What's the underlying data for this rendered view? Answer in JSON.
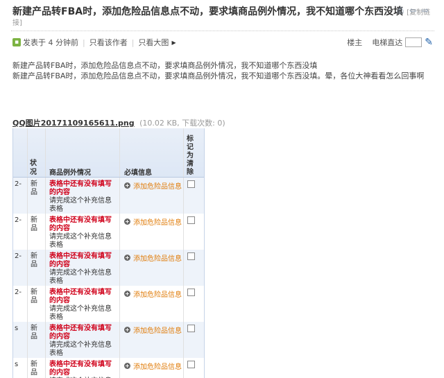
{
  "thread": {
    "title": "新建产品转FBA时，添加危险品信息点不动，要求填商品例外情况，我不知道哪个东西没填",
    "copy_link": "[复制链",
    "copy_link_end": "接]"
  },
  "meta": {
    "posted": "发表于 4 分钟前",
    "only_author": "只看该作者",
    "big_image": "只看大图",
    "floor": "楼主",
    "goto_label": "电梯直达"
  },
  "post": {
    "line1": "新建产品转FBA时，添加危险品信息点不动，要求填商品例外情况，我不知道哪个东西没填",
    "line2": "新建产品转FBA时，添加危险品信息点不动，要求填商品例外情况，我不知道哪个东西没填。晕，各位大神看看怎么回事啊"
  },
  "attachment": {
    "name": "QQ图片20171109165611.png",
    "info": "(10.02 KB, 下载次数: 0)"
  },
  "screenshot_table": {
    "headers": {
      "status": "状况",
      "info": "商品例外情况",
      "required": "必填信息",
      "mark": "标记为清除"
    },
    "rows": [
      {
        "id": "2-",
        "status": "新品",
        "warn": "表格中还有没有填写的内容",
        "note": "请完成这个补充信息表格",
        "action": "添加危险品信息"
      },
      {
        "id": "2-",
        "status": "新品",
        "warn": "表格中还有没有填写的内容",
        "note": "请完成这个补充信息表格",
        "action": "添加危险品信息"
      },
      {
        "id": "2-",
        "status": "新品",
        "warn": "表格中还有没有填写的内容",
        "note": "请完成这个补充信息表格",
        "action": "添加危险品信息"
      },
      {
        "id": "2-",
        "status": "新品",
        "warn": "表格中还有没有填写的内容",
        "note": "请完成这个补充信息表格",
        "action": "添加危险品信息"
      },
      {
        "id": "s",
        "status": "新品",
        "warn": "表格中还有没有填写的内容",
        "note": "请完成这个补充信息表格",
        "action": "添加危险品信息"
      },
      {
        "id": "s",
        "status": "新品",
        "warn": "表格中还有没有填写的内容",
        "note": "请完成这个补充信息表格",
        "action": "添加危险品信息"
      }
    ]
  }
}
